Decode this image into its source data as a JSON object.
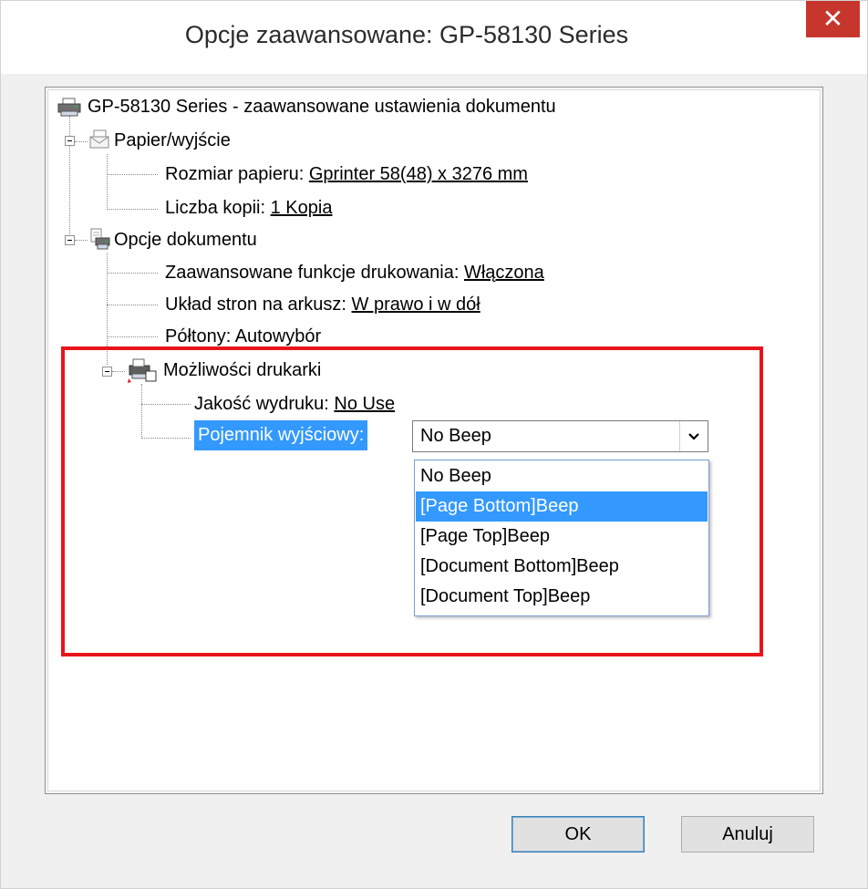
{
  "window": {
    "title": "Opcje zaawansowane: GP-58130 Series",
    "close_glyph": "✕"
  },
  "tree": {
    "root": "GP-58130 Series - zaawansowane ustawienia dokumentu",
    "paper": {
      "label": "Papier/wyjście",
      "size_label": "Rozmiar papieru:",
      "size_value": "Gprinter 58(48) x 3276 mm",
      "copies_label": "Liczba kopii:",
      "copies_value": "1 Kopia"
    },
    "document": {
      "label": "Opcje dokumentu",
      "advanced_label": "Zaawansowane funkcje drukowania:",
      "advanced_value": "Włączona",
      "layout_label": "Układ stron na arkusz:",
      "layout_value": "W prawo i w dół",
      "halftone": "Półtony: Autowybór",
      "features": {
        "label": "Możliwości drukarki",
        "quality_label": "Jakość wydruku:",
        "quality_value": "No Use",
        "output_bin_label": "Pojemnik wyjściowy:"
      }
    }
  },
  "combo": {
    "selected": "No Beep",
    "arrow_glyph": "⌄",
    "options": [
      "No Beep",
      "[Page Bottom]Beep",
      "[Page Top]Beep",
      "[Document Bottom]Beep",
      "[Document Top]Beep"
    ],
    "highlighted": "[Page Bottom]Beep"
  },
  "buttons": {
    "ok": "OK",
    "cancel": "Anuluj"
  },
  "colors": {
    "highlight": "#3399ff",
    "annotation_box": "#e8141c",
    "close_button": "#c7362c"
  },
  "icons": {
    "root": "printer-icon",
    "paper": "paper-envelope-icon",
    "document": "document-printer-icon",
    "features": "printer-features-icon"
  }
}
